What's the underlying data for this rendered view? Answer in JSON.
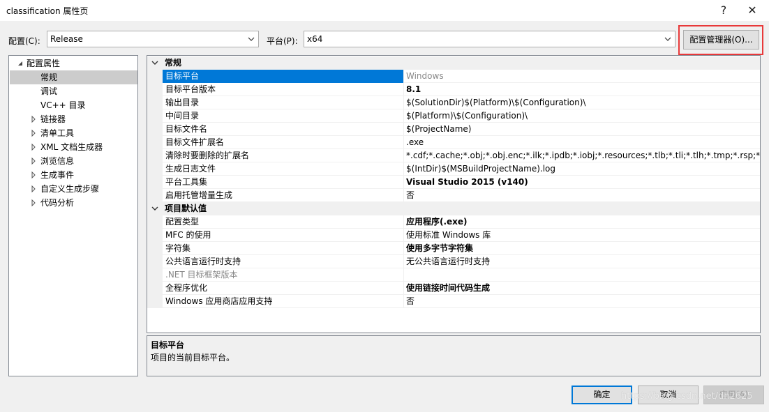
{
  "window": {
    "title": "classification 属性页",
    "help": "?",
    "close": "✕"
  },
  "config": {
    "label": "配置(C):",
    "value": "Release"
  },
  "platform": {
    "label": "平台(P):",
    "value": "x64"
  },
  "config_manager": {
    "label": "配置管理器(O)...",
    "highlight_color": "#e8393a"
  },
  "tree": {
    "root": "配置属性",
    "items": [
      {
        "label": "常规",
        "selected": true,
        "expandable": false
      },
      {
        "label": "调试",
        "expandable": false
      },
      {
        "label": "VC++ 目录",
        "expandable": false
      },
      {
        "label": "链接器",
        "expandable": true
      },
      {
        "label": "清单工具",
        "expandable": true
      },
      {
        "label": "XML 文档生成器",
        "expandable": true
      },
      {
        "label": "浏览信息",
        "expandable": true
      },
      {
        "label": "生成事件",
        "expandable": true
      },
      {
        "label": "自定义生成步骤",
        "expandable": true
      },
      {
        "label": "代码分析",
        "expandable": true
      }
    ]
  },
  "grid": {
    "sections": [
      {
        "title": "常规",
        "rows": [
          {
            "name": "目标平台",
            "value": "Windows",
            "selected": true,
            "gray_value": true
          },
          {
            "name": "目标平台版本",
            "value": "8.1",
            "bold": true
          },
          {
            "name": "输出目录",
            "value": "$(SolutionDir)$(Platform)\\$(Configuration)\\"
          },
          {
            "name": "中间目录",
            "value": "$(Platform)\\$(Configuration)\\"
          },
          {
            "name": "目标文件名",
            "value": "$(ProjectName)"
          },
          {
            "name": "目标文件扩展名",
            "value": ".exe"
          },
          {
            "name": "清除时要删除的扩展名",
            "value": "*.cdf;*.cache;*.obj;*.obj.enc;*.ilk;*.ipdb;*.iobj;*.resources;*.tlb;*.tli;*.tlh;*.tmp;*.rsp;*.pgc;*.pg"
          },
          {
            "name": "生成日志文件",
            "value": "$(IntDir)$(MSBuildProjectName).log"
          },
          {
            "name": "平台工具集",
            "value": "Visual Studio 2015 (v140)",
            "bold": true
          },
          {
            "name": "启用托管增量生成",
            "value": "否"
          }
        ]
      },
      {
        "title": "项目默认值",
        "rows": [
          {
            "name": "配置类型",
            "value": "应用程序(.exe)",
            "bold": true
          },
          {
            "name": "MFC 的使用",
            "value": "使用标准 Windows 库"
          },
          {
            "name": "字符集",
            "value": "使用多字节字符集",
            "bold": true
          },
          {
            "name": "公共语言运行时支持",
            "value": "无公共语言运行时支持"
          },
          {
            "name": ".NET 目标框架版本",
            "value": "",
            "gray_name": true
          },
          {
            "name": "全程序优化",
            "value": "使用链接时间代码生成",
            "bold": true
          },
          {
            "name": "Windows 应用商店应用支持",
            "value": "否"
          }
        ]
      }
    ]
  },
  "description": {
    "title": "目标平台",
    "text": "项目的当前目标平台。"
  },
  "buttons": {
    "ok": "确定",
    "cancel": "取消",
    "apply": "应用(A)"
  },
  "watermark": "https://blog.csdn.net/dn2625",
  "colors": {
    "selection": "#0078d7",
    "tree_selection": "#cccccc"
  }
}
